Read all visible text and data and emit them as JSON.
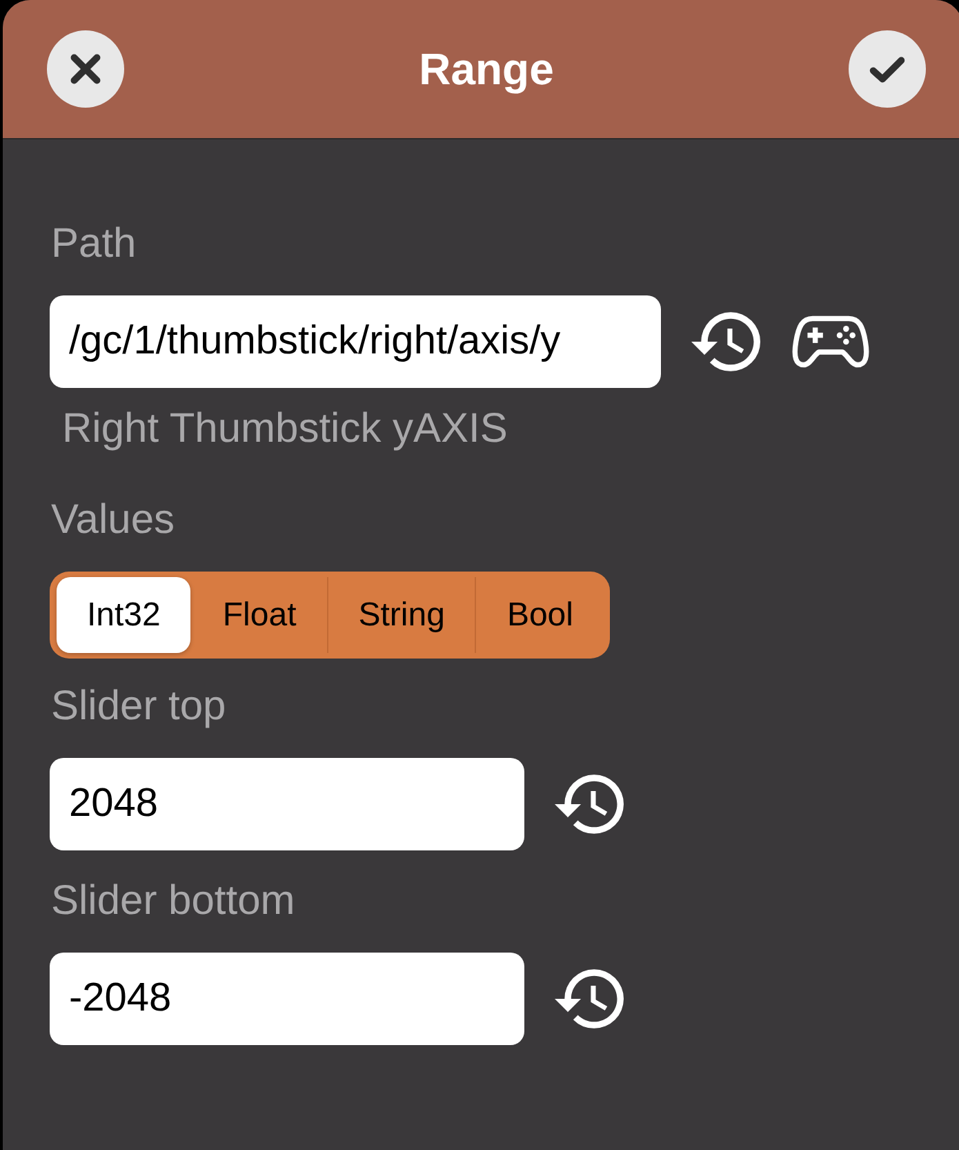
{
  "header": {
    "title": "Range"
  },
  "path": {
    "label": "Path",
    "value": "/gc/1/thumbstick/right/axis/y",
    "description": "Right Thumbstick yAXIS"
  },
  "values": {
    "label": "Values",
    "options": [
      {
        "label": "Int32",
        "selected": true
      },
      {
        "label": "Float",
        "selected": false
      },
      {
        "label": "String",
        "selected": false
      },
      {
        "label": "Bool",
        "selected": false
      }
    ]
  },
  "slider_fields": [
    {
      "label": "Slider top",
      "value": "2048"
    },
    {
      "label": "Slider bottom",
      "value": "-2048"
    }
  ]
}
